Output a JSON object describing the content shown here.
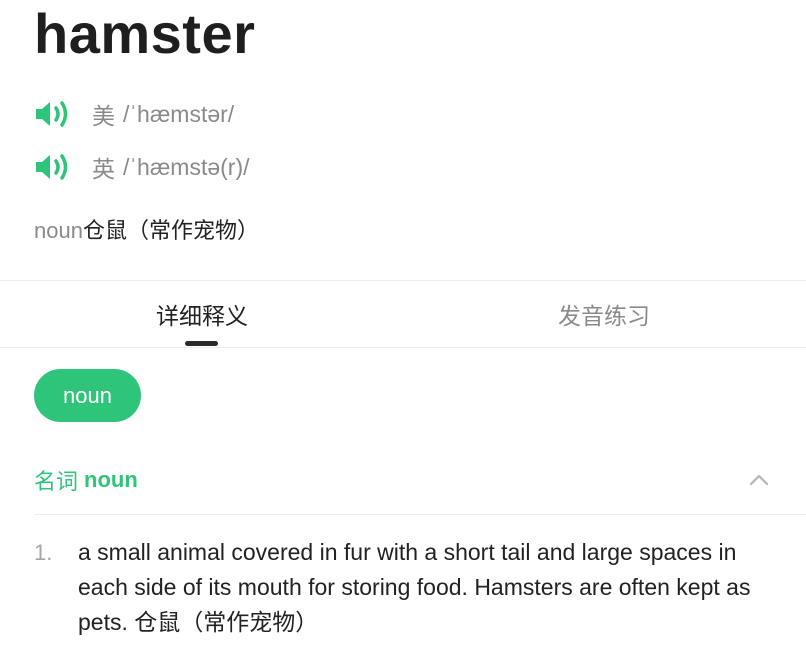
{
  "entry": {
    "word": "hamster"
  },
  "pronunciations": [
    {
      "label": "美",
      "ipa": "/ˈhæmstər/",
      "icon": "speaker-icon"
    },
    {
      "label": "英",
      "ipa": "/ˈhæmstə(r)/",
      "icon": "speaker-icon"
    }
  ],
  "summary": {
    "pos": "noun",
    "meaning": "仓鼠（常作宠物）"
  },
  "tabs": [
    {
      "label": "详细释义",
      "active": true
    },
    {
      "label": "发音练习",
      "active": false
    }
  ],
  "pos_chip": {
    "label": "noun"
  },
  "section": {
    "cn_label": "名词",
    "en_label": "noun",
    "icon": "chevron-up-icon"
  },
  "definitions": [
    {
      "number": "1.",
      "text": "a small animal covered in fur with a short tail and large spaces in each side of its mouth for storing food. Hamsters are often kept as pets. 仓鼠（常作宠物）"
    }
  ],
  "colors": {
    "accent": "#2ec47a",
    "text": "#222222",
    "muted": "#8a8a8a"
  }
}
